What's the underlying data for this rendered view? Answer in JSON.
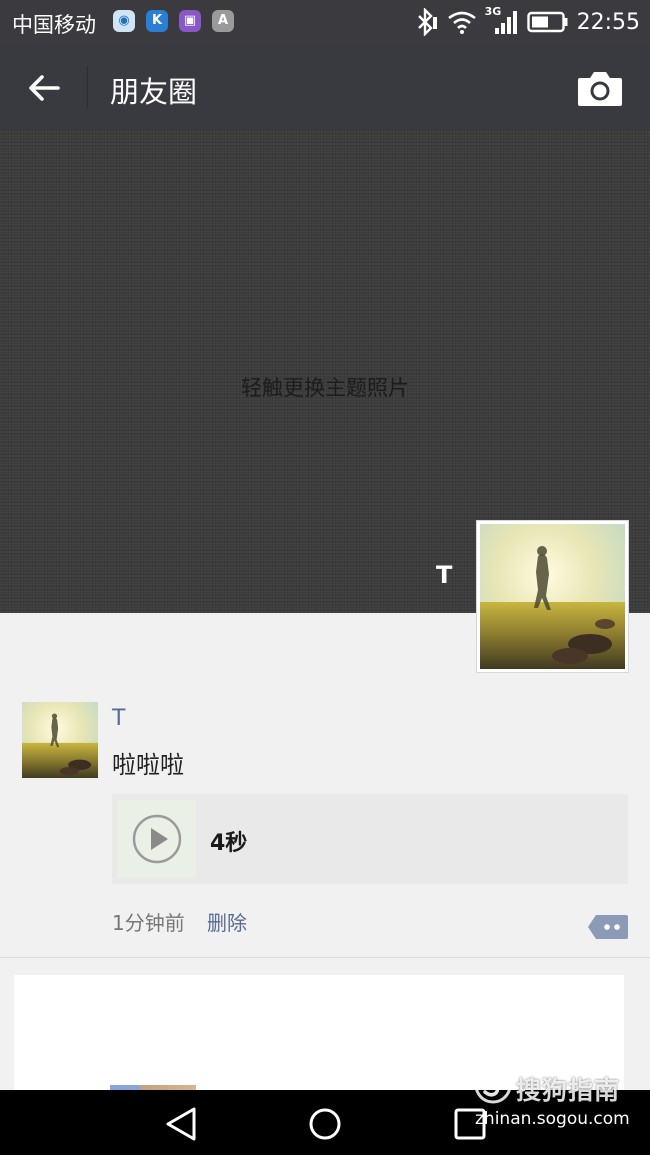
{
  "status_bar": {
    "carrier": "中国移动",
    "app_icons": [
      {
        "name": "cloud-app-icon",
        "bg": "#3aa0d8",
        "glyph": "◉"
      },
      {
        "name": "k-app-icon",
        "bg": "#2a7fd4",
        "glyph": "K"
      },
      {
        "name": "gallery-app-icon",
        "bg": "#8a57c7",
        "glyph": "▣"
      },
      {
        "name": "a-app-icon",
        "bg": "#8a8a8a",
        "glyph": "A"
      }
    ],
    "network": "3G",
    "time": "22:55"
  },
  "nav": {
    "title": "朋友圈",
    "back_icon": "arrow-left-icon",
    "camera_icon": "camera-icon"
  },
  "cover": {
    "hint": "轻触更换主题照片",
    "profile_name": "T"
  },
  "post": {
    "author": "T",
    "text": "啦啦啦",
    "voice_duration": "4秒",
    "time": "1分钟前",
    "delete_label": "删除"
  },
  "watermark": {
    "name": "搜狗指南",
    "url": "zhinan.sogou.com"
  },
  "colors": {
    "navbar": "#393a3f",
    "link_blue": "#576b95",
    "page_bg": "#f1f1f1"
  }
}
